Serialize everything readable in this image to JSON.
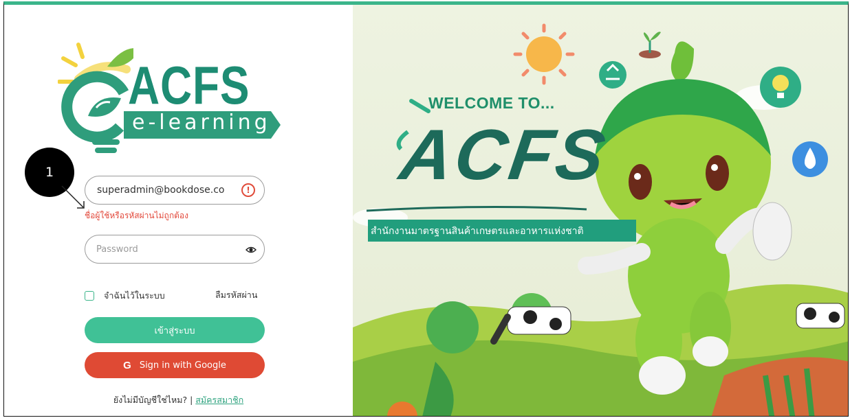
{
  "logo": {
    "brand": "ACFS",
    "sub": "e-learning"
  },
  "annotation": {
    "badge": "1"
  },
  "login_form": {
    "email_value": "superadmin@bookdose.co",
    "error_message": "ชื่อผู้ใช้หรือรหัสผ่านไม่ถูกต้อง",
    "password_placeholder": "Password",
    "remember_label": "จำฉันไว้ในระบบ",
    "forgot_label": "ลืมรหัสผ่าน",
    "login_button": "เข้าสู่ระบบ",
    "google_button": "Sign in with Google",
    "signup_prompt": "ยังไม่มีบัญชีใช่ไหม? | ",
    "signup_link": "สมัครสมาชิก"
  },
  "banner": {
    "welcome": "WELCOME TO...",
    "title": "ACFS",
    "org_name": "สำนักงานมาตรฐานสินค้าเกษตรและอาหารแห่งชาติ"
  },
  "colors": {
    "brand_green": "#40c196",
    "error_red": "#e2483a",
    "google_red": "#df4a34",
    "top_bar": "#3bb58a"
  }
}
